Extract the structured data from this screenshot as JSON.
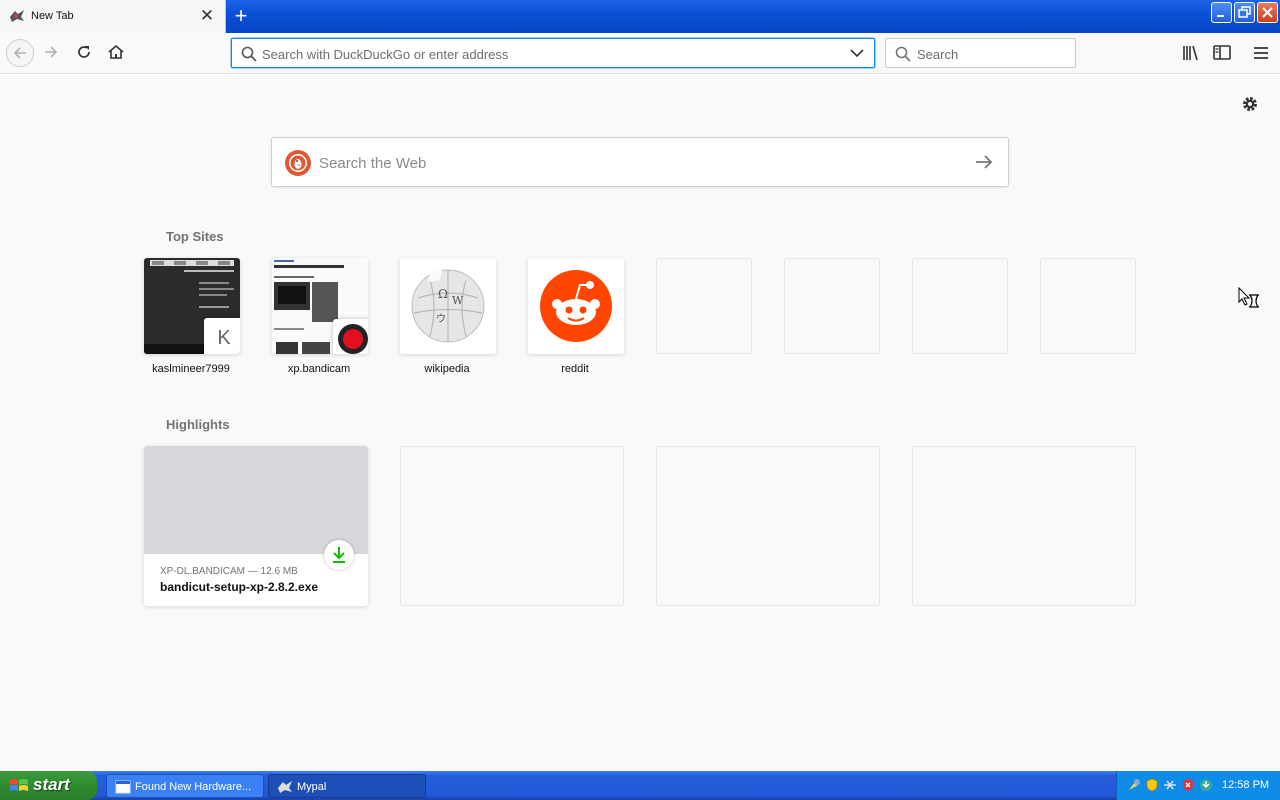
{
  "browser": {
    "tab": {
      "title": "New Tab",
      "close_glyph": "✕"
    },
    "new_tab_glyph": "+",
    "urlbar": {
      "placeholder": "Search with DuckDuckGo or enter address"
    },
    "searchbar": {
      "placeholder": "Search"
    }
  },
  "newtab": {
    "web_search": {
      "placeholder": "Search the Web"
    },
    "top_sites": {
      "title": "Top Sites",
      "sites": [
        {
          "label": "kaslmineer7999",
          "badge": "K"
        },
        {
          "label": "xp.bandicam"
        },
        {
          "label": "wikipedia"
        },
        {
          "label": "reddit"
        }
      ]
    },
    "highlights": {
      "title": "Highlights",
      "items": [
        {
          "meta": "XP-DL.BANDICAM — 12.6 MB",
          "title": "bandicut-setup-xp-2.8.2.exe"
        }
      ]
    }
  },
  "taskbar": {
    "start_label": "start",
    "tasks": [
      {
        "label": "Found New Hardware..."
      },
      {
        "label": "Mypal"
      }
    ],
    "clock": "12:58 PM"
  },
  "colors": {
    "accent": "#0a84ff",
    "reddit": "#ff4500",
    "xp_blue": "#245edb",
    "start_green": "#2f8c2f"
  }
}
